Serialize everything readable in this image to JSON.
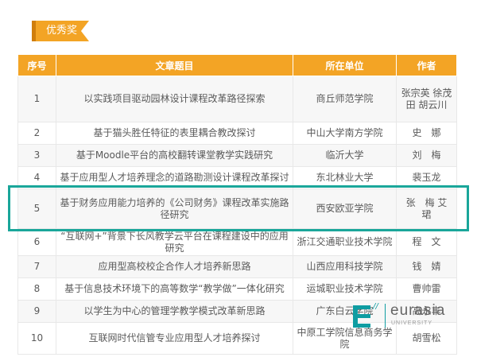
{
  "section": {
    "title": "优秀奖"
  },
  "table": {
    "headers": [
      "序号",
      "文章题目",
      "所在单位",
      "作者"
    ],
    "rows": [
      {
        "no": "1",
        "title": "以实践项目驱动园林设计课程改革路径探索",
        "unit": "商丘师范学院",
        "author": "张宗英 徐茂田 胡云川"
      },
      {
        "no": "2",
        "title": "基于猫头胜任特征的表里耦合教改探讨",
        "unit": "中山大学南方学院",
        "author": "史　娜"
      },
      {
        "no": "3",
        "title": "基于Moodle平台的高校翻转课堂教学实践研究",
        "unit": "临沂大学",
        "author": "刘　梅"
      },
      {
        "no": "4",
        "title": "基于应用型人才培养理念的道路勘测设计课程改革探讨",
        "unit": "东北林业大学",
        "author": "裴玉龙"
      },
      {
        "no": "5",
        "title": "基于财务应用能力培养的《公司财务》课程改革实施路径研究",
        "unit": "西安欧亚学院",
        "author": "张　梅 艾　珺"
      },
      {
        "no": "6",
        "title": "“互联网+”背景下长风教学云平台在课程建设中的应用研究",
        "unit": "浙江交通职业技术学院",
        "author": "程　文"
      },
      {
        "no": "7",
        "title": "应用型高校校企合作人才培养新思路",
        "unit": "山西应用科技学院",
        "author": "钱　婧"
      },
      {
        "no": "8",
        "title": "基于信息技术环境下的高等数学“教学做”一体化研究",
        "unit": "运城职业技术学院",
        "author": "曹帅雷"
      },
      {
        "no": "9",
        "title": "以学生为中心的管理学教学模式改革新思路",
        "unit": "广东白云学院",
        "author": "高永丰"
      },
      {
        "no": "10",
        "title": "互联网时代信管专业应用型人才培养探讨",
        "unit": "中原工学院信息商务学院",
        "author": "胡雪松"
      }
    ]
  },
  "logo": {
    "text": "eurasia",
    "sub": "UNIVERSITY"
  },
  "colors": {
    "accent": "#f3a425",
    "highlight": "#1aa69a",
    "brand": "#0f9da2"
  }
}
